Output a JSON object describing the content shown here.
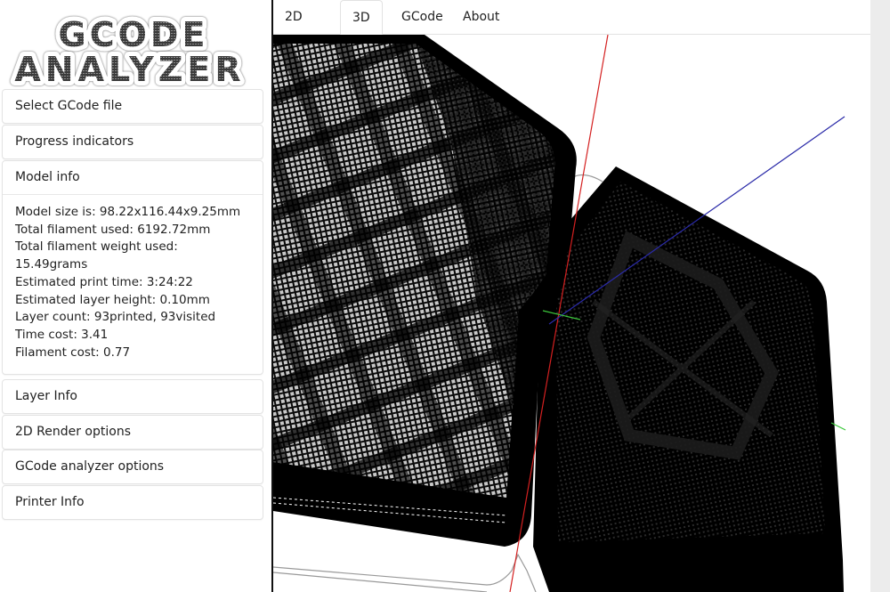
{
  "app": {
    "logo_line1": "GCODE",
    "logo_line2": "ANALYZER"
  },
  "sidebar": {
    "panels": [
      {
        "label": "Select GCode file",
        "expanded": false
      },
      {
        "label": "Progress indicators",
        "expanded": false
      },
      {
        "label": "Model info",
        "expanded": true
      },
      {
        "label": "Layer Info",
        "expanded": false
      },
      {
        "label": "2D Render options",
        "expanded": false
      },
      {
        "label": "GCode analyzer options",
        "expanded": false
      },
      {
        "label": "Printer Info",
        "expanded": false
      }
    ],
    "model_info": {
      "model_size": "Model size is: 98.22x116.44x9.25mm",
      "filament_used": "Total filament used: 6192.72mm",
      "filament_weight_label": "Total filament weight used:",
      "filament_weight_value": "15.49grams",
      "print_time": "Estimated print time: 3:24:22",
      "layer_height": "Estimated layer height: 0.10mm",
      "layer_count": "Layer count: 93printed, 93visited",
      "time_cost": "Time cost: 3.41",
      "filament_cost": "Filament cost: 0.77"
    }
  },
  "viewer": {
    "tabs": [
      {
        "label": "2D",
        "active": false
      },
      {
        "label": "3D",
        "active": true
      },
      {
        "label": "GCode",
        "active": false
      },
      {
        "label": "About",
        "active": false
      }
    ],
    "axis_colors": {
      "x": "#d42020",
      "y": "#2a2aa8",
      "z": "#3cc83c"
    }
  }
}
